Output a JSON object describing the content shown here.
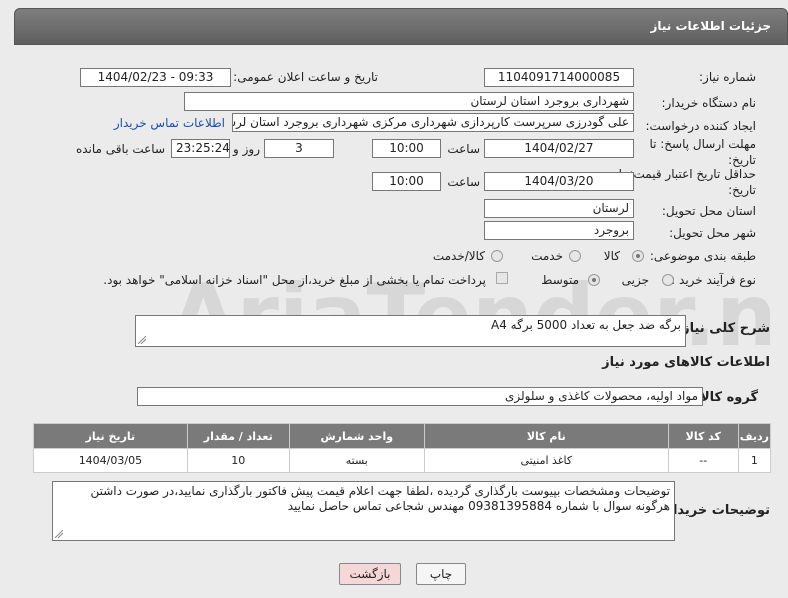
{
  "header": {
    "title": "جزئیات اطلاعات نیاز"
  },
  "fields": {
    "need_number_label": "شماره نیاز:",
    "need_number": "1104091714000085",
    "announce_label": "تاریخ و ساعت اعلان عمومی:",
    "announce_value": "1404/02/23 - 09:33",
    "buyer_org_label": "نام دستگاه خریدار:",
    "buyer_org": "شهرداری بروجرد استان لرستان",
    "creator_label": "ایجاد کننده درخواست:",
    "creator": "علی گودرزی سرپرست کارپردازی شهرداری مرکزی شهرداری بروجرد استان لرستان",
    "contact_link": "اطلاعات تماس خریدار",
    "reply_deadline_label": "مهلت ارسال پاسخ: تا تاریخ:",
    "reply_date": "1404/02/27",
    "time_label": "ساعت",
    "reply_time": "10:00",
    "days_value": "3",
    "days_label": "روز و",
    "remaining_value": "23:25:24",
    "remaining_label": "ساعت باقی مانده",
    "price_deadline_label": "حداقل تاریخ اعتبار قیمت: تا تاریخ:",
    "price_date": "1404/03/20",
    "price_time": "10:00",
    "province_label": "استان محل تحویل:",
    "province": "لرستان",
    "city_label": "شهر محل تحویل:",
    "city": "بروجرد",
    "category_label": "طبقه بندی موضوعی:",
    "category_options": [
      "کالا",
      "خدمت",
      "کالا/خدمت"
    ],
    "process_label": "نوع فرآیند خرید :",
    "process_options": [
      "جزیی",
      "متوسط"
    ],
    "payment_note": "پرداخت تمام یا بخشی از مبلغ خرید،از محل \"اسناد خزانه اسلامی\" خواهد بود."
  },
  "description": {
    "label": "شرح کلی نیاز:",
    "value": "برگه ضد جعل به تعداد 5000  برگه A4"
  },
  "goods": {
    "section_title": "اطلاعات کالاهای مورد نیاز",
    "group_label": "گروه کالا:",
    "group_value": "مواد اولیه، محصولات کاغذی و سلولزی",
    "columns": [
      "ردیف",
      "کد کالا",
      "نام کالا",
      "واحد شمارش",
      "تعداد / مقدار",
      "تاریخ نیاز"
    ],
    "rows": [
      [
        "1",
        "--",
        "کاغذ امنیتی",
        "بسته",
        "10",
        "1404/03/05"
      ]
    ]
  },
  "buyer_notes": {
    "label": "توضیحات خریدار:",
    "value": "توضیحات ومشخصات بپیوست بارگذاری گردیده ،لطفا جهت اعلام قیمت پیش فاکتور بارگذاری نمایید،در صورت داشتن هرگونه سوال با شماره 09381395884 مهندس شجاعی تماس حاصل نمایید"
  },
  "buttons": {
    "print": "چاپ",
    "back": "بازگشت"
  },
  "watermark": "AriaTender.neT",
  "colors": {
    "header": "#6b6b6b",
    "link": "#1a4fb3",
    "back_button": "#f6d7d7"
  }
}
